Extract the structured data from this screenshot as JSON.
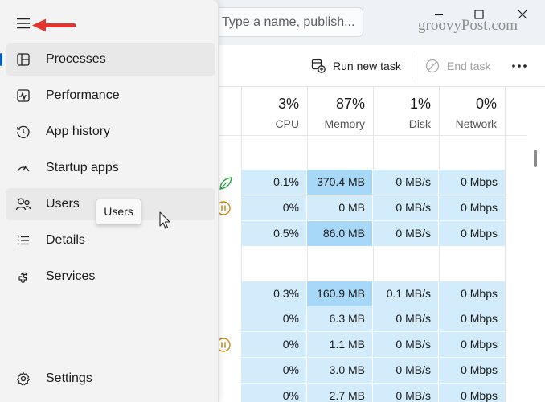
{
  "search": {
    "placeholder": "Type a name, publish..."
  },
  "watermark": "groovyPost.com",
  "toolbar": {
    "run_new_task": "Run new task",
    "end_task": "End task"
  },
  "columns": [
    {
      "percent": "3%",
      "label": "CPU"
    },
    {
      "percent": "87%",
      "label": "Memory"
    },
    {
      "percent": "1%",
      "label": "Disk"
    },
    {
      "percent": "0%",
      "label": "Network"
    }
  ],
  "rows": [
    {
      "cpu": "0.1%",
      "memory": "370.4 MB",
      "disk": "0 MB/s",
      "network": "0 Mbps",
      "icon": "leaf-icon"
    },
    {
      "cpu": "0%",
      "memory": "0 MB",
      "disk": "0 MB/s",
      "network": "0 Mbps",
      "icon": "pause-icon"
    },
    {
      "cpu": "0.5%",
      "memory": "86.0 MB",
      "disk": "0 MB/s",
      "network": "0 Mbps",
      "icon": ""
    },
    {
      "cpu": "0.3%",
      "memory": "160.9 MB",
      "disk": "0.1 MB/s",
      "network": "0 Mbps",
      "icon": ""
    },
    {
      "cpu": "0%",
      "memory": "6.3 MB",
      "disk": "0 MB/s",
      "network": "0 Mbps",
      "icon": ""
    },
    {
      "cpu": "0%",
      "memory": "1.1 MB",
      "disk": "0 MB/s",
      "network": "0 Mbps",
      "icon": "pause-icon"
    },
    {
      "cpu": "0%",
      "memory": "3.0 MB",
      "disk": "0 MB/s",
      "network": "0 Mbps",
      "icon": ""
    },
    {
      "cpu": "0%",
      "memory": "2.7 MB",
      "disk": "0 MB/s",
      "network": "0 Mbps",
      "icon": ""
    }
  ],
  "nav": {
    "items": [
      {
        "label": "Processes",
        "icon": "processes-icon"
      },
      {
        "label": "Performance",
        "icon": "performance-icon"
      },
      {
        "label": "App history",
        "icon": "history-icon"
      },
      {
        "label": "Startup apps",
        "icon": "startup-icon"
      },
      {
        "label": "Users",
        "icon": "users-icon"
      },
      {
        "label": "Details",
        "icon": "details-icon"
      },
      {
        "label": "Services",
        "icon": "services-icon"
      }
    ],
    "settings": {
      "label": "Settings",
      "icon": "gear-icon"
    },
    "tooltip": "Users"
  },
  "colors": {
    "accent": "#005fb8",
    "row_bg": "#d3ecfc",
    "memory_highlight": "#a8d8f8",
    "annotation_arrow": "#e3342f"
  }
}
